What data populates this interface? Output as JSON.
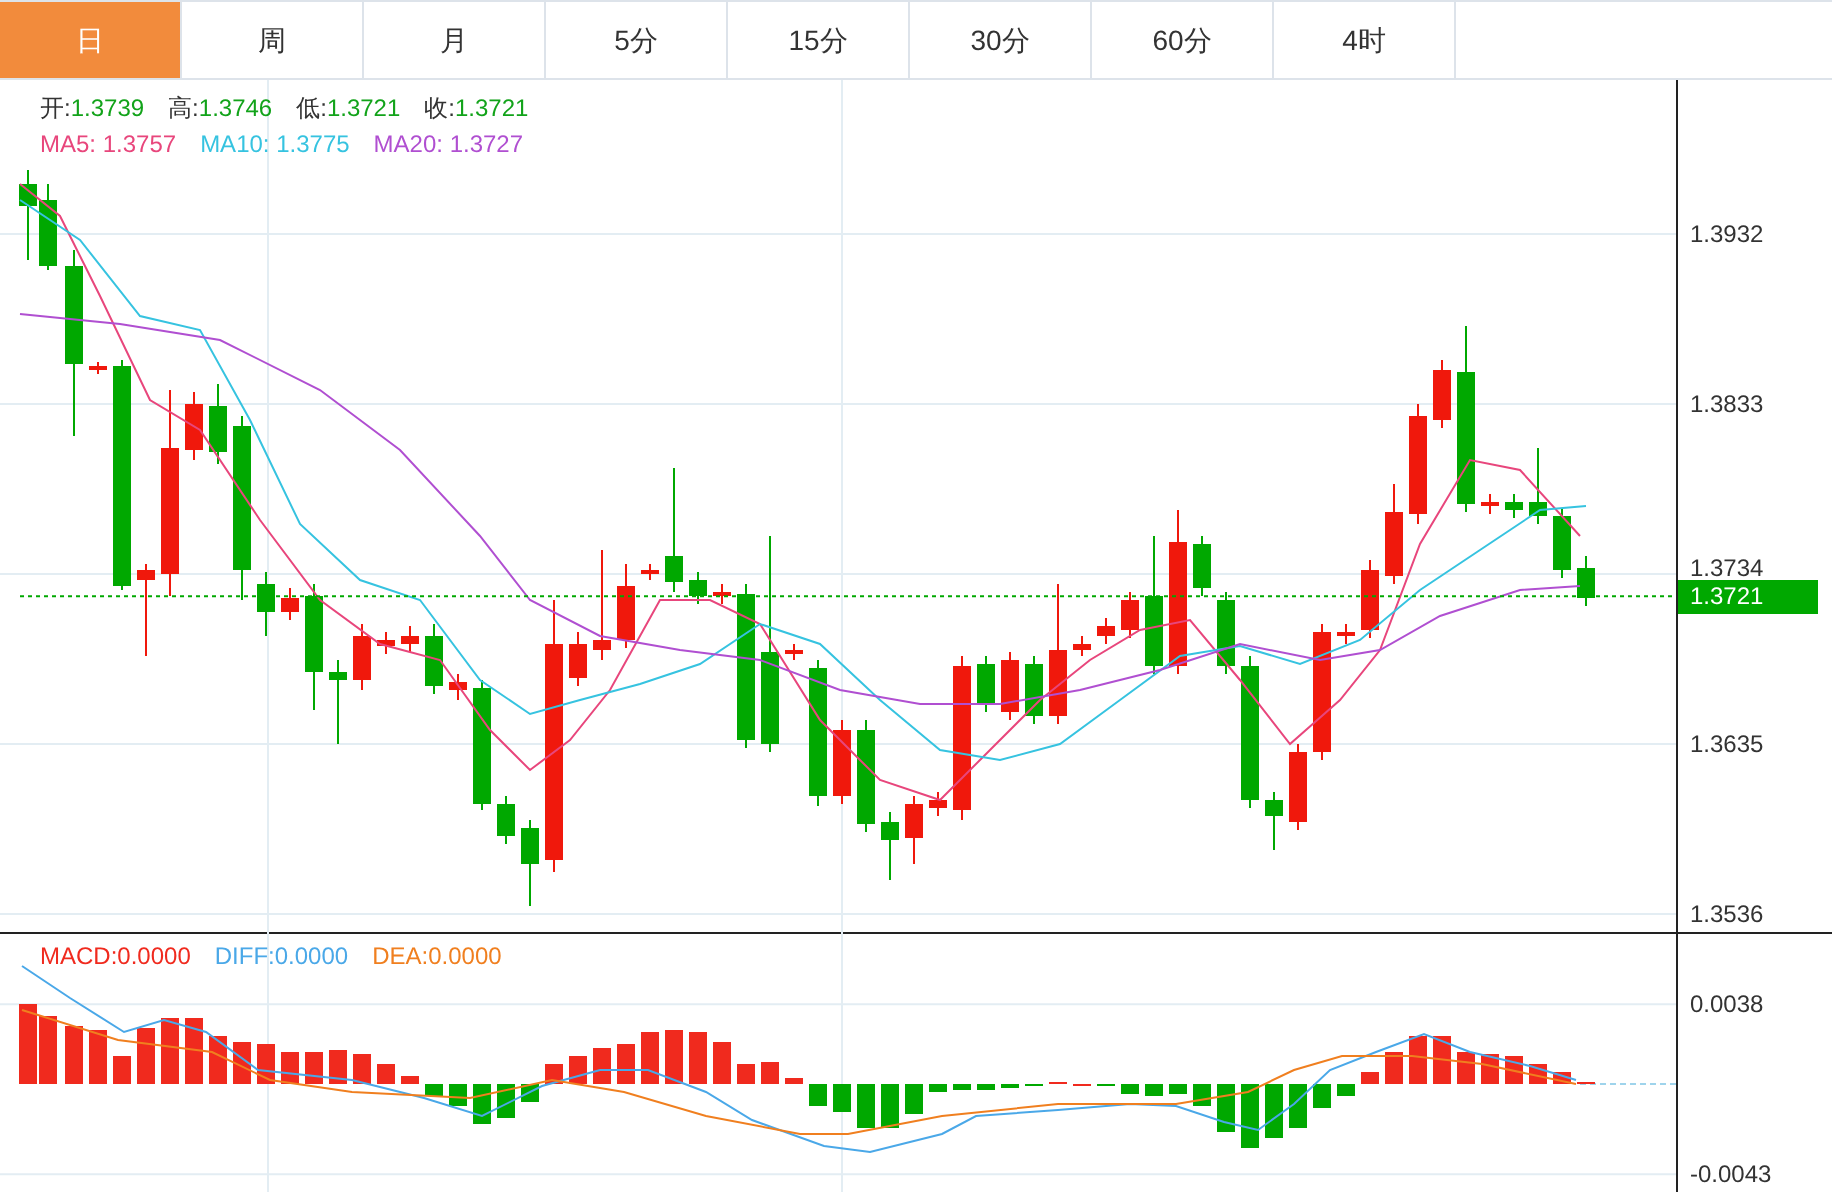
{
  "tabs": [
    {
      "label": "日",
      "selected": true
    },
    {
      "label": "周",
      "selected": false
    },
    {
      "label": "月",
      "selected": false
    },
    {
      "label": "5分",
      "selected": false
    },
    {
      "label": "15分",
      "selected": false
    },
    {
      "label": "30分",
      "selected": false
    },
    {
      "label": "60分",
      "selected": false
    },
    {
      "label": "4时",
      "selected": false
    }
  ],
  "price_chart": {
    "ohlc": [
      {
        "label": "开:",
        "value": "1.3739"
      },
      {
        "label": "高:",
        "value": "1.3746"
      },
      {
        "label": "低:",
        "value": "1.3721"
      },
      {
        "label": "收:",
        "value": "1.3721"
      }
    ],
    "moving_averages": [
      {
        "label": "MA5:",
        "value": "1.3757",
        "color": "#e8467c"
      },
      {
        "label": "MA10:",
        "value": "1.3775",
        "color": "#36c3e0"
      },
      {
        "label": "MA20:",
        "value": "1.3727",
        "color": "#b04fd1"
      }
    ],
    "axis_ticks": [
      "1.3932",
      "1.3833",
      "1.3734",
      "1.3635",
      "1.3536"
    ],
    "current_price": "1.3721"
  },
  "macd_chart": {
    "legend": [
      {
        "label": "MACD:",
        "value": "0.0000",
        "color": "#f02a1e"
      },
      {
        "label": "DIFF:",
        "value": "0.0000",
        "color": "#4aa8e8"
      },
      {
        "label": "DEA:",
        "value": "0.0000",
        "color": "#f07f1f"
      }
    ],
    "axis_ticks": [
      "0.0038",
      "-0.0043"
    ]
  }
}
